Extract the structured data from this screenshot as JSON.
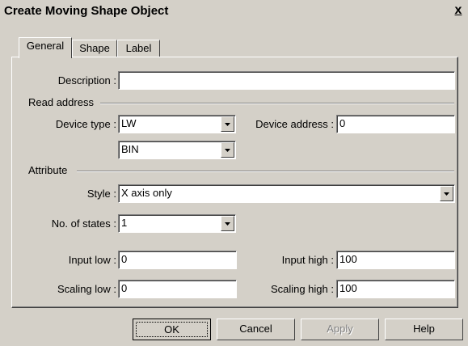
{
  "window": {
    "title": "Create Moving Shape Object",
    "close_label": "x"
  },
  "tabs": [
    {
      "label": "General",
      "active": true
    },
    {
      "label": "Shape",
      "active": false
    },
    {
      "label": "Label",
      "active": false
    }
  ],
  "general": {
    "description_label": "Description :",
    "description_value": "",
    "read_address_group": "Read address",
    "device_type_label": "Device type :",
    "device_type_value": "LW",
    "device_address_label": "Device address :",
    "device_address_value": "0",
    "format_value": "BIN",
    "attribute_group": "Attribute",
    "style_label": "Style :",
    "style_value": "X axis only",
    "states_label": "No. of states :",
    "states_value": "1",
    "input_low_label": "Input low :",
    "input_low_value": "0",
    "input_high_label": "Input high :",
    "input_high_value": "100",
    "scaling_low_label": "Scaling low :",
    "scaling_low_value": "0",
    "scaling_high_label": "Scaling high :",
    "scaling_high_value": "100"
  },
  "buttons": {
    "ok": "OK",
    "cancel": "Cancel",
    "apply": "Apply",
    "help": "Help"
  }
}
